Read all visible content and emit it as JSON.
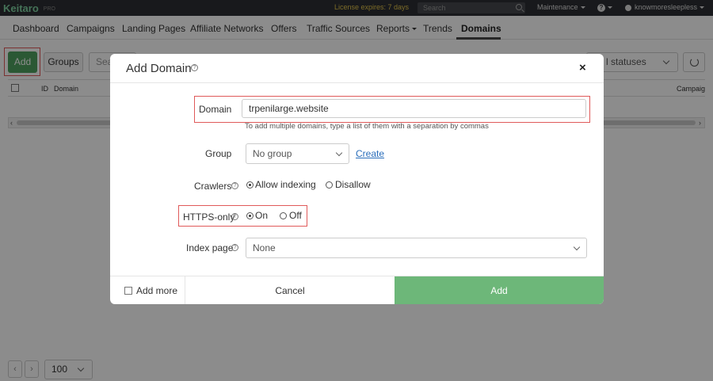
{
  "topbar": {
    "logo": "Keitaro",
    "logo_sub": "PRO",
    "license": "License expires: 7 days",
    "search_placeholder": "Search",
    "maintenance": "Maintenance",
    "help": "?",
    "user": "knowmoresleepless"
  },
  "nav": {
    "items": [
      "Dashboard",
      "Campaigns",
      "Landing Pages",
      "Affiliate Networks",
      "Offers",
      "Traffic Sources",
      "Reports",
      "Trends",
      "Domains"
    ],
    "active": "Domains"
  },
  "toolbar": {
    "add_label": "Add",
    "groups_label": "Groups",
    "search_placeholder": "Sea",
    "status_value": "l statuses"
  },
  "table": {
    "columns": [
      "ID",
      "Domain",
      "Campaig"
    ]
  },
  "footer": {
    "prev": "‹",
    "next": "›",
    "per_page": "100"
  },
  "modal": {
    "title": "Add Domain",
    "help": "?",
    "close": "×",
    "domain_label": "Domain",
    "domain_value": "trpenilarge.website",
    "domain_hint": "To add multiple domains, type a list of them with a separation by commas",
    "group_label": "Group",
    "group_value": "No group",
    "create_link": "Create",
    "crawlers_label": "Crawlers",
    "crawlers_options": [
      "Allow indexing",
      "Disallow"
    ],
    "crawlers_selected": "Allow indexing",
    "https_label": "HTTPS-only",
    "https_options": [
      "On",
      "Off"
    ],
    "https_selected": "On",
    "index_label": "Index page",
    "index_value": "None",
    "add_more_label": "Add more",
    "cancel_label": "Cancel",
    "submit_label": "Add"
  },
  "colors": {
    "accent_green": "#6db779",
    "highlight_red": "#e05a5a",
    "license_yellow": "#e2c34a"
  }
}
